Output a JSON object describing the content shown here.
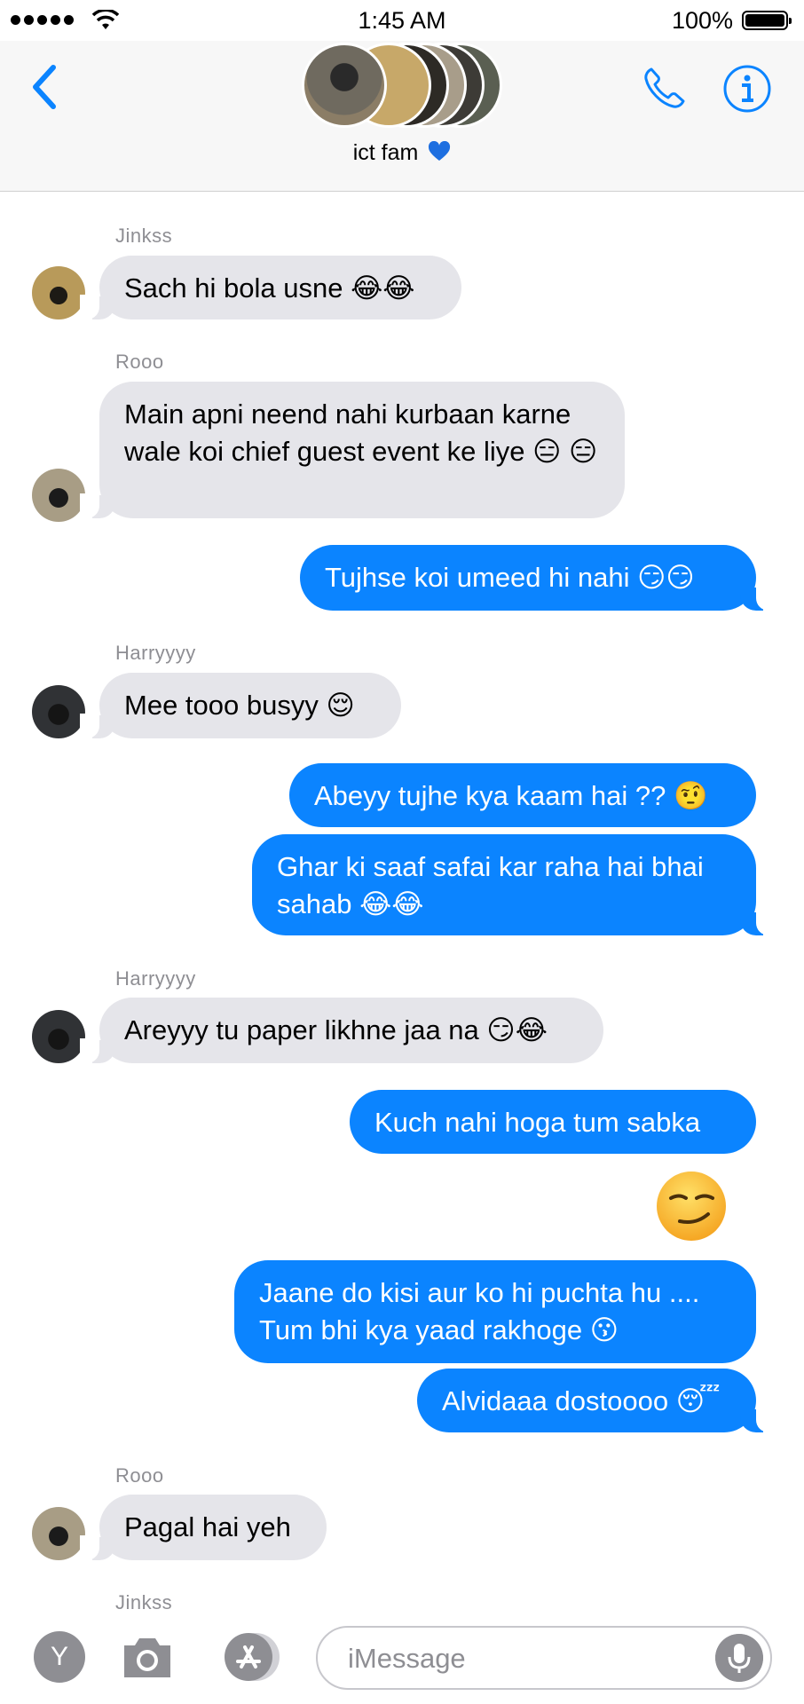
{
  "status_bar": {
    "time": "1:45 AM",
    "battery_pct": "100%"
  },
  "header": {
    "group_name": "ict fam"
  },
  "colors": {
    "accent": "#0b84ff",
    "incoming_bubble": "#e5e5ea",
    "heart": "#1e6fe0"
  },
  "messages": [
    {
      "sender": "Jinkss",
      "text": "Sach hi bola usne 😂😂"
    },
    {
      "sender": "Rooo",
      "text": "Main apni neend nahi kurbaan karne wale koi chief guest event ke liye 😑 😑"
    },
    {
      "text": "Tujhse koi umeed hi nahi 😏😏"
    },
    {
      "sender": "Harryyyy",
      "text": "Mee tooo busyy 😌"
    },
    {
      "text": "Abeyy tujhe kya kaam hai ?? 🤨"
    },
    {
      "text": "Ghar ki saaf safai kar raha hai bhai sahab 😂😂"
    },
    {
      "sender": "Harryyyy",
      "text": "Areyyy tu paper likhne jaa na 😏😂"
    },
    {
      "text": "Kuch nahi hoga tum sabka"
    },
    {
      "text": "Jaane do kisi aur ko hi puchta hu .... Tum bhi kya yaad rakhoge 😗"
    },
    {
      "text": "Alvidaaa dostoooo 😴"
    },
    {
      "sender": "Rooo",
      "text": "Pagal hai yeh"
    },
    {
      "sender": "Jinkss"
    }
  ],
  "big_emoji": "smirk-emoji",
  "input": {
    "apps_button": "Y",
    "placeholder": "iMessage"
  }
}
